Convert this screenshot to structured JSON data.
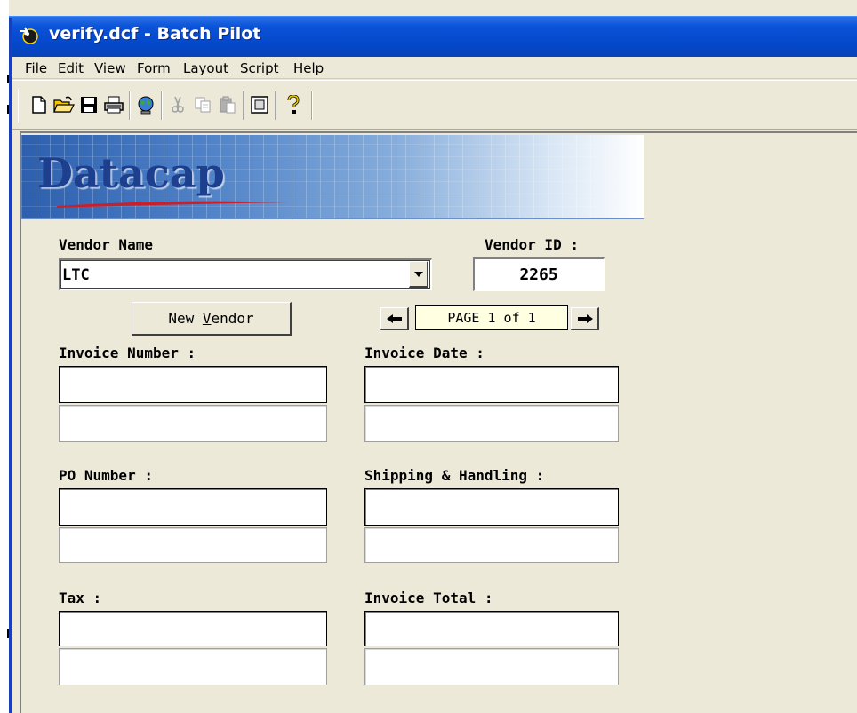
{
  "window": {
    "title": "verify.dcf - Batch Pilot"
  },
  "menu": {
    "items": [
      "File",
      "Edit",
      "View",
      "Form",
      "Layout",
      "Script",
      "Help"
    ]
  },
  "toolbar": {
    "buttons": [
      "new-icon",
      "open-icon",
      "save-icon",
      "print-icon",
      "globe-icon",
      "cut-icon",
      "copy-icon",
      "paste-icon",
      "form-icon",
      "help-icon"
    ]
  },
  "banner": {
    "logo_text": "Datacap"
  },
  "form": {
    "vendor_name_label": "Vendor Name",
    "vendor_name_value": "LTC",
    "vendor_id_label": "Vendor ID :",
    "vendor_id_value": "2265",
    "new_vendor_label_pre": "New ",
    "new_vendor_label_accel": "V",
    "new_vendor_label_post": "endor",
    "page_indicator": "PAGE 1 of 1",
    "invoice_number_label": "Invoice Number :",
    "invoice_date_label": "Invoice Date :",
    "po_number_label": "PO Number :",
    "shipping_label": "Shipping & Handling :",
    "tax_label": "Tax :",
    "invoice_total_label": "Invoice Total :"
  },
  "colors": {
    "titlebar": "#0a52d8",
    "chrome": "#ece9d8",
    "page_indicator_bg": "#ffffe1",
    "logo": "#1d3f8e"
  }
}
